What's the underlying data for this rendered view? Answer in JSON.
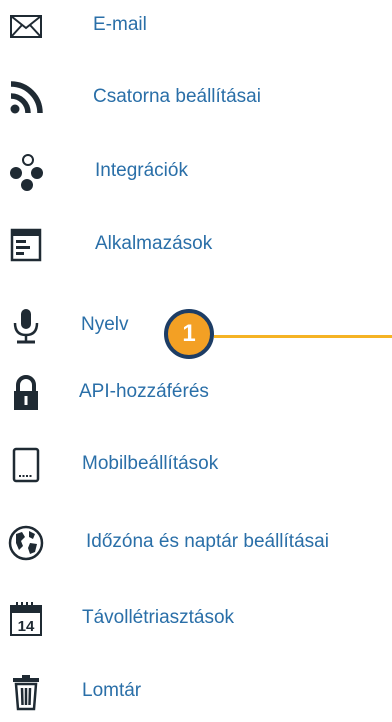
{
  "menu": {
    "items": [
      {
        "label": "E-mail",
        "icon": "envelope-icon"
      },
      {
        "label": "Csatorna beállításai",
        "icon": "rss-feed-icon"
      },
      {
        "label": "Integrációk",
        "icon": "integrations-icon"
      },
      {
        "label": "Alkalmazások",
        "icon": "application-window-icon"
      },
      {
        "label": "Nyelv",
        "icon": "microphone-icon"
      },
      {
        "label": "API-hozzáférés",
        "icon": "lock-icon"
      },
      {
        "label": "Mobilbeállítások",
        "icon": "mobile-phone-icon"
      },
      {
        "label": "Időzóna és naptár beállításai",
        "icon": "globe-icon"
      },
      {
        "label": "Távollétriasztások",
        "icon": "calendar-icon"
      },
      {
        "label": "Lomtár",
        "icon": "trash-icon"
      }
    ]
  },
  "callout": {
    "number": "1"
  },
  "colors": {
    "link": "#2a6fa8",
    "icon": "#1f2a33",
    "callout_fill": "#f3a024",
    "callout_border": "#1d3d65",
    "callout_line": "#f5b324"
  }
}
